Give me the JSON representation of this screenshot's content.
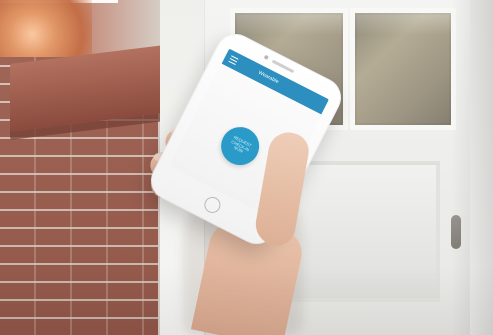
{
  "app": {
    "title": "Wearable",
    "button_label": "REQUEST\nCHECK-IN NOW"
  },
  "colors": {
    "header": "#2c8fbf",
    "button": "#2a9bc8",
    "phone": "#ffffff"
  },
  "icons": {
    "menu": "menu-icon"
  }
}
